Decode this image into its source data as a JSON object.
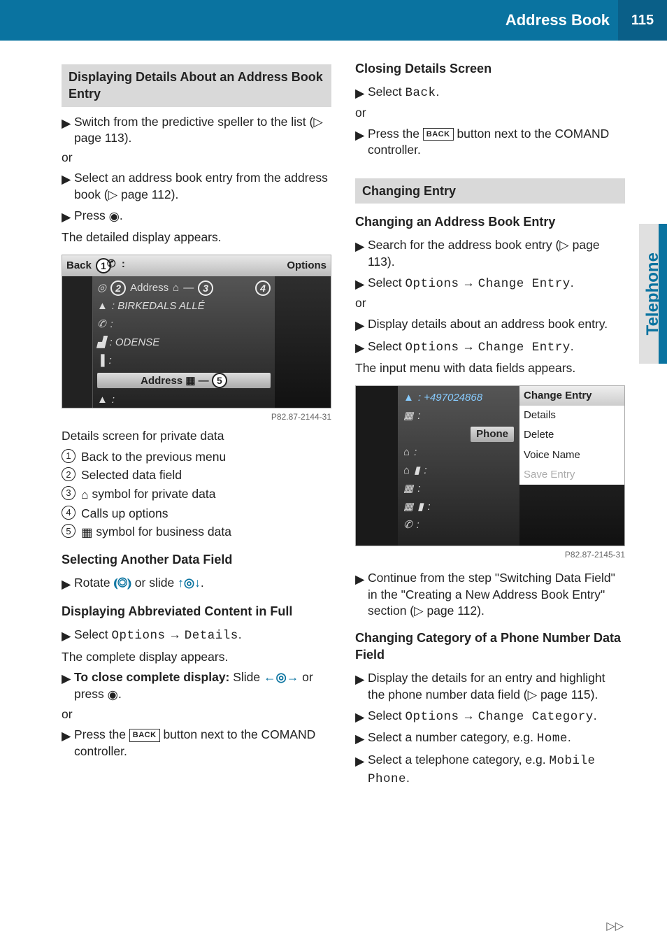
{
  "header": {
    "title": "Address Book",
    "page_number": "115"
  },
  "side_tab": "Telephone",
  "left": {
    "h_display_details": "Displaying Details About an Address Book Entry",
    "s1": "Switch from the predictive speller to the list (▷ page 113).",
    "or": "or",
    "s2": "Select an address book entry from the address book (▷ page 112).",
    "s3a": "Press ",
    "s3b": ".",
    "s3_result": "The detailed display appears.",
    "fig1": {
      "back": "Back",
      "options": "Options",
      "address_label": "Address",
      "street": ": BIRKEDALS ALLÉ",
      "city": ": ODENSE",
      "address_bar": "Address",
      "code": "P82.87-2144-31"
    },
    "fig1_caption": "Details screen for private data",
    "legend": {
      "l1": "Back to the previous menu",
      "l2": "Selected data field",
      "l3": " symbol for private data",
      "l4": "Calls up options",
      "l5": " symbol for business data"
    },
    "h_select_field": "Selecting Another Data Field",
    "rotate": "Rotate ",
    "or_slide": " or slide ",
    "dot": ".",
    "h_abbrev": "Displaying Abbreviated Content in Full",
    "abbrev_s1a": "Select ",
    "abbrev_s1_opt": "Options",
    "abbrev_s1_det": "Details",
    "abbrev_s1_result": "The complete display appears.",
    "abbrev_s2_lead": "To close complete display:",
    "abbrev_s2_body": " Slide ",
    "abbrev_s2_tail": " or press ",
    "abbrev_s3a": "Press the ",
    "back_key": "BACK",
    "abbrev_s3b": " button next to the COMAND controller."
  },
  "right": {
    "h_closing": "Closing Details Screen",
    "close_s1a": "Select ",
    "close_s1_back": "Back",
    "close_s2a": "Press the ",
    "close_s2b": " button next to the COMAND controller.",
    "h_changing_entry": "Changing Entry",
    "h_changing_ab": "Changing an Address Book Entry",
    "ch_s1": "Search for the address book entry (▷ page 113).",
    "ch_s2a": "Select ",
    "ch_opt": "Options",
    "ch_ce": "Change Entry",
    "ch_s3": "Display details about an address book entry.",
    "ch_s4_result": "The input menu with data fields appears.",
    "fig2": {
      "number": ": +497024868",
      "menu_header": "Change Entry",
      "menu_items": [
        "Details",
        "Delete",
        "Voice Name",
        "Save Entry"
      ],
      "phone_tag": "Phone",
      "code": "P82.87-2145-31"
    },
    "cont": "Continue from the step \"Switching Data Field\" in the \"Creating a New Address Book Entry\" section (▷ page 112).",
    "h_changing_cat": "Changing Category of a Phone Number Data Field",
    "cat_s1": "Display the details for an entry and highlight the phone number data field (▷ page 115).",
    "cat_s2a": "Select ",
    "cat_cc": "Change Category",
    "cat_s3a": "Select a number category, e.g. ",
    "cat_home": "Home",
    "cat_s4a": "Select a telephone category, e.g. ",
    "cat_mobile": "Mobile Phone"
  },
  "continues": "▷▷"
}
